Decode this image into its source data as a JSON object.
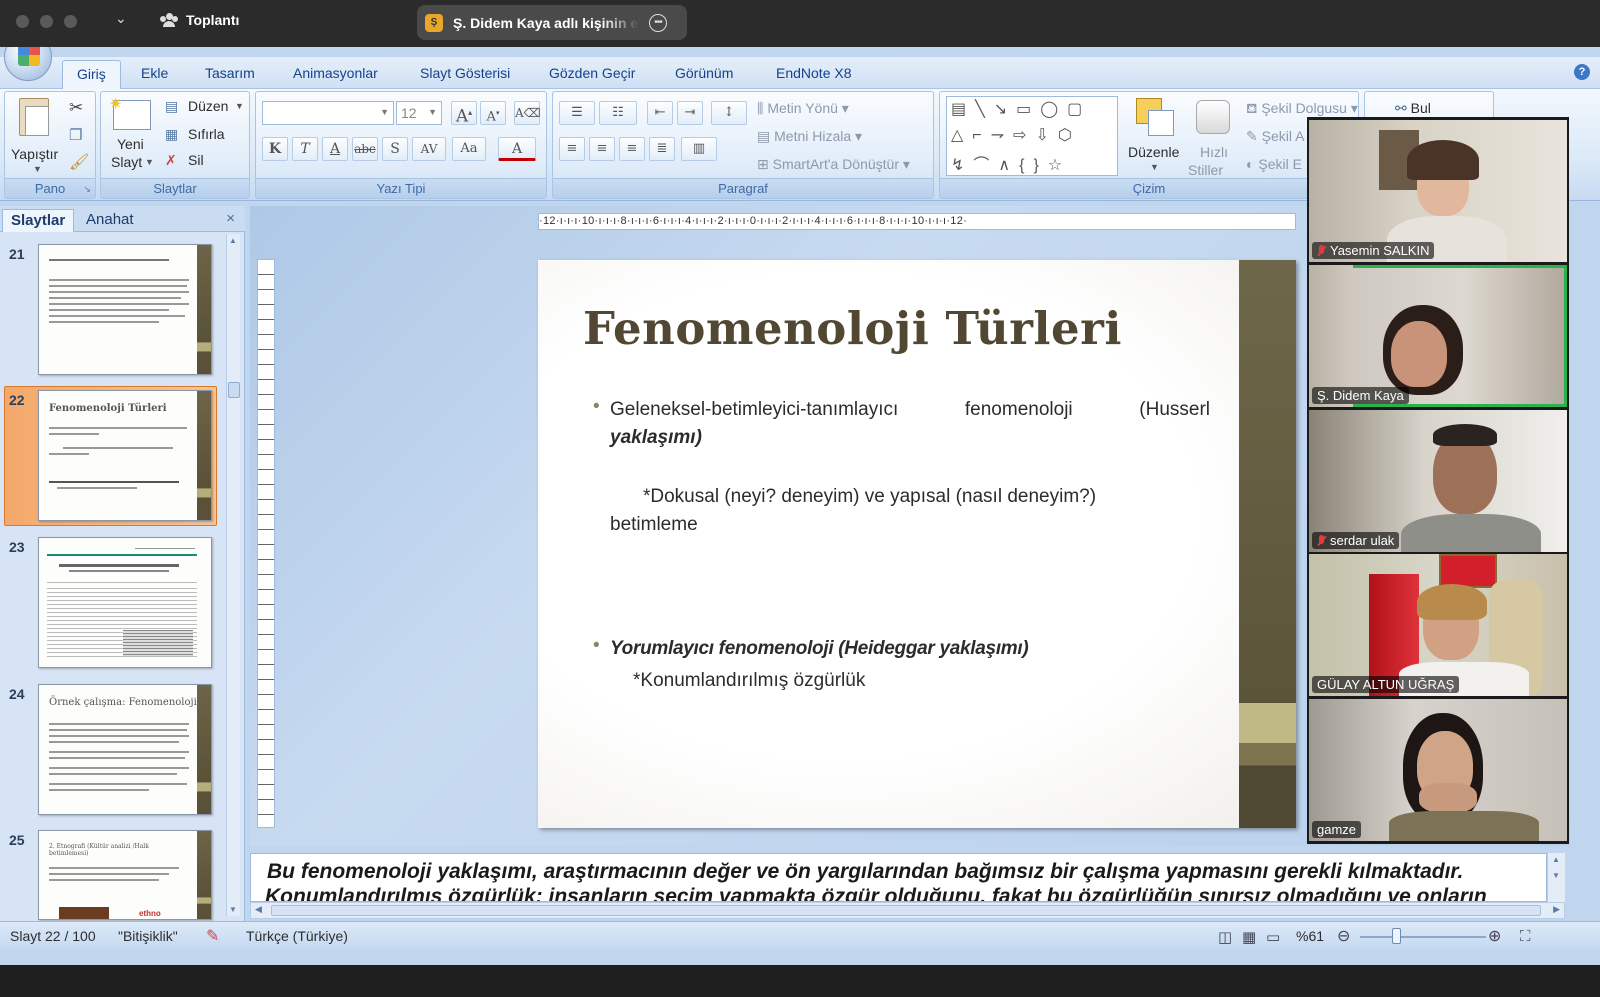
{
  "zoom": {
    "meeting_label": "Toplantı",
    "share_badge": "Ş",
    "share_label": "Ş. Didem Kaya adlı kişinin ekranı"
  },
  "ribbon": {
    "tabs": [
      "Giriş",
      "Ekle",
      "Tasarım",
      "Animasyonlar",
      "Slayt Gösterisi",
      "Gözden Geçir",
      "Görünüm",
      "EndNote X8"
    ],
    "groups": {
      "pano": "Pano",
      "slaytlar": "Slaytlar",
      "yazi_tipi": "Yazı Tipi",
      "paragraf": "Paragraf",
      "cizim": "Çizim"
    },
    "paste_label": "Yapıştır",
    "new_slide_label_1": "Yeni",
    "new_slide_label_2": "Slayt",
    "layout_label": "Düzen",
    "reset_label": "Sıfırla",
    "delete_label": "Sil",
    "font_size": "12",
    "text_direction": "Metin Yönü",
    "align_text": "Metni Hizala",
    "smartart": "SmartArt'a Dönüştür",
    "arrange_label": "Düzenle",
    "quick_styles_1": "Hızlı",
    "quick_styles_2": "Stiller",
    "shape_fill": "Şekil Dolgusu",
    "shape_outline": "Şekil A",
    "shape_effects": "Şekil E",
    "find_label": "Bul",
    "font_buttons": [
      "K",
      "T",
      "A",
      "abc",
      "S",
      "AV",
      "Aa",
      "A"
    ]
  },
  "pane": {
    "tab_slides": "Slaytlar",
    "tab_outline": "Anahat",
    "close": "×",
    "thumbnails": [
      {
        "num": "21",
        "title": ""
      },
      {
        "num": "22",
        "title": "Fenomenoloji Türleri"
      },
      {
        "num": "23",
        "title": ""
      },
      {
        "num": "24",
        "title": "Örnek çalışma: Fenomenoloji"
      },
      {
        "num": "25",
        "title": "2. Etnografi (Kültür analizi /Halk betimlemesi)"
      }
    ]
  },
  "ruler": {
    "horizontal": "·12·ı·ı·ı·10·ı·ı·ı·8·ı·ı·ı·6·ı·ı·ı·4·ı·ı·ı·2·ı·ı·ı·0·ı·ı·ı·2·ı·ı·ı·4·ı·ı·ı·6·ı·ı·ı·8·ı·ı·ı·10·ı·ı·ı·12·"
  },
  "slide": {
    "title": "Fenomenoloji Türleri",
    "bullet1_line1": "Geleneksel-betimleyici-tanımlayıcı fenomenoloji (Husserl",
    "bullet1_line2": "yaklaşımı)",
    "sub1_line1": "*Dokusal (neyi? deneyim) ve yapısal (nasıl deneyim?)",
    "sub1_line2": "betimleme",
    "bullet2": "Yorumlayıcı fenomenoloji (Heideggar yaklaşımı)",
    "sub2": "*Konumlandırılmış özgürlük",
    "bullet_glyph": "•"
  },
  "notes": {
    "line1": "Bu fenomenoloji yaklaşımı, araştırmacının değer ve ön yargılarından bağımsız bir çalışma yapmasını gerekli kılmaktadır.",
    "line2": "Konumlandırılmış özgürlük: insanların seçim yapmakta özgür olduğunu, fakat bu özgürlüğün sınırsız olmadığını ve onların"
  },
  "status": {
    "slide_pos": "Slayt 22 / 100",
    "theme": "\"Bitişiklik\"",
    "language": "Türkçe (Türkiye)",
    "zoom": "%61"
  },
  "participants": [
    {
      "name": "Yasemin SALKIN",
      "muted": true
    },
    {
      "name": "Ş. Didem Kaya",
      "muted": false
    },
    {
      "name": "serdar ulak",
      "muted": true
    },
    {
      "name": "GÜLAY ALTUN UĞRAŞ",
      "muted": false
    },
    {
      "name": "gamze",
      "muted": false
    }
  ],
  "colors": {
    "speaking_outline": "#2bb24c",
    "slide_title": "#524733",
    "accent_strip": "#5c5439"
  }
}
